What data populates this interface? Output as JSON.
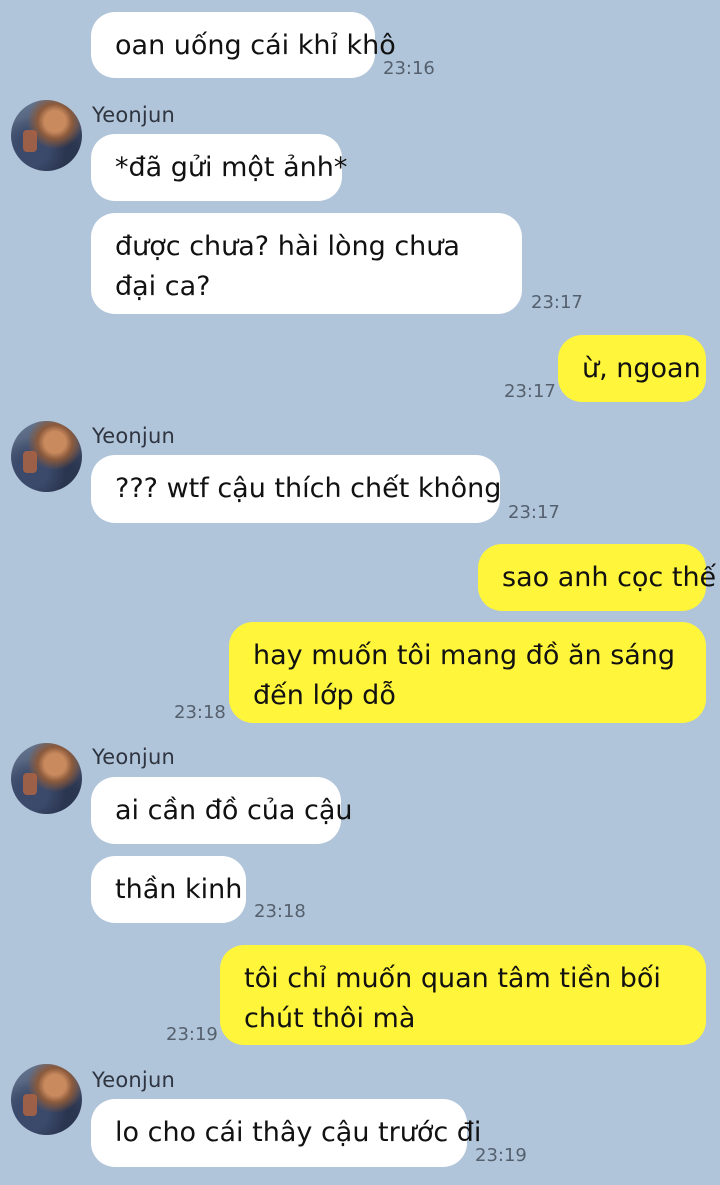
{
  "messages": [
    {
      "text": "oan uống cái khỉ khô",
      "time": "23:16"
    },
    {
      "sender": "Yeonjun",
      "text": "*đã gửi một ảnh*"
    },
    {
      "text": "được chưa? hài lòng chưa đại ca?",
      "time": "23:17"
    },
    {
      "text": "ừ, ngoan",
      "time": "23:17"
    },
    {
      "sender": "Yeonjun",
      "text": "??? wtf cậu thích chết không",
      "time": "23:17"
    },
    {
      "text": "sao anh cọc thế"
    },
    {
      "text": "hay muốn tôi mang đồ ăn sáng đến lớp dỗ",
      "time": "23:18"
    },
    {
      "sender": "Yeonjun",
      "text": "ai cần đồ của cậu"
    },
    {
      "text": "thần kinh",
      "time": "23:18"
    },
    {
      "text": "tôi chỉ muốn quan tâm tiền bối chút thôi mà",
      "time": "23:19"
    },
    {
      "sender": "Yeonjun",
      "text": "lo cho cái thây cậu trước đi",
      "time": "23:19"
    }
  ]
}
